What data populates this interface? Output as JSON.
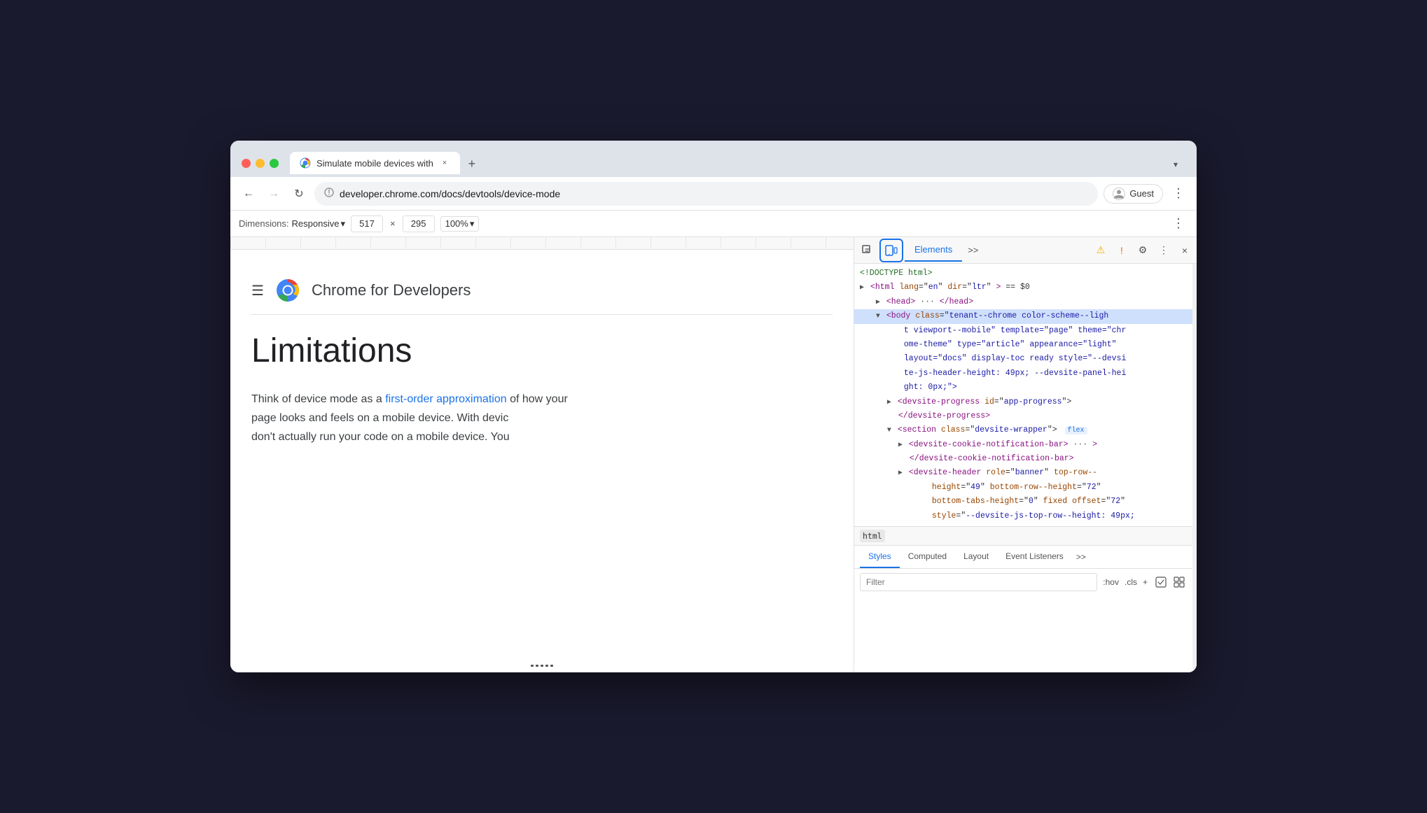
{
  "window": {
    "title": "Simulate mobile devices with",
    "tab_close_label": "×",
    "tab_new_label": "+",
    "dropdown_label": "▾"
  },
  "tab": {
    "title": "Simulate mobile devices with",
    "favicon": "chrome"
  },
  "nav": {
    "back_disabled": false,
    "forward_disabled": true,
    "url": "developer.chrome.com/docs/devtools/device-mode",
    "profile_label": "Guest",
    "menu_label": "⋮"
  },
  "device_toolbar": {
    "dimensions_label": "Dimensions:",
    "dimensions_value": "Responsive",
    "width_value": "517",
    "height_value": "295",
    "zoom_value": "100%",
    "separator": "×"
  },
  "page": {
    "hamburger": "☰",
    "brand": "Chrome for Developers",
    "heading": "Limitations",
    "paragraph1_start": "Think of device mode as a ",
    "paragraph1_link": "first-order approximation",
    "paragraph1_end": "of how your",
    "paragraph2": "page looks and feels on a mobile device. With devic",
    "paragraph3": "don't actually run your code on a mobile device. You"
  },
  "devtools": {
    "elements_tab": "Elements",
    "more_tab": ">>",
    "dom": {
      "line1": "<!DOCTYPE html>",
      "line2_start": "<html lang=\"en\" dir=\"ltr\"> == $0",
      "line3": "<head> ··· </head>",
      "line4_start": "<body class=\"tenant--chrome color-scheme--ligh",
      "line4_cont": "t viewport--mobile\" template=\"page\" theme=\"chr",
      "line4_cont2": "ome-theme\" type=\"article\" appearance=\"light\"",
      "line4_cont3": "layout=\"docs\" display-toc ready style=\"--devsi",
      "line4_cont4": "te-js-header-height: 49px; --devsite-panel-hei",
      "line4_cont5": "ght: 0px;\">",
      "line5": "<devsite-progress id=\"app-progress\">",
      "line6": "</devsite-progress>",
      "line7_start": "<section class=\"devsite-wrapper\">",
      "line7_badge": "flex",
      "line8": "<devsite-cookie-notification-bar> ··· >",
      "line9": "</devsite-cookie-notification-bar>",
      "line10_start": "<devsite-header role=\"banner\" top-row--",
      "line10_cont": "height=\"49\" bottom-row--height=\"72\"",
      "line10_cont2": "bottom-tabs-height=\"0\" fixed offset=\"72\"",
      "line10_cont3": "style=\"--devsite-js-top-row--height: 49px;"
    },
    "breadcrumb": "html",
    "styles_tab": "Styles",
    "computed_tab": "Computed",
    "layout_tab": "Layout",
    "event_listeners_tab": "Event Listeners",
    "styles_more": ">>",
    "filter_placeholder": "Filter",
    "filter_hov": ":hov",
    "filter_cls": ".cls",
    "filter_add": "+",
    "filter_icon1": "⊡",
    "filter_icon2": "⊞"
  }
}
